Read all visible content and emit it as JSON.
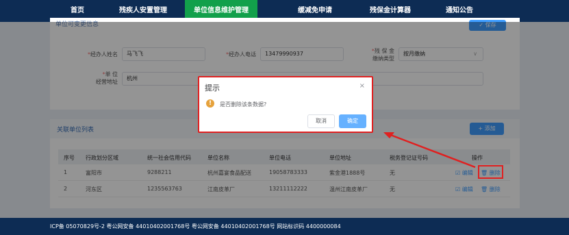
{
  "nav": {
    "items": [
      "首页",
      "残疾人安置管理",
      "单位信息维护管理",
      "缓减免申请",
      "残保金计算器",
      "通知公告"
    ],
    "active_index": 2
  },
  "card1": {
    "title": "单位可变更信息",
    "save_label": "✓ 保存",
    "fields": {
      "agent_name_label": "经办人姓名",
      "agent_name_value": "马飞飞",
      "agent_phone_label": "经办人电话",
      "agent_phone_value": "13479990937",
      "pay_type_label_1": "残 保 金",
      "pay_type_label_2": "缴纳类型",
      "pay_type_value": "按月缴纳",
      "address_label_1": "单 位",
      "address_label_2": "经营地址",
      "address_value": "杭州"
    }
  },
  "table": {
    "title": "关联单位列表",
    "add_label": "+ 添加",
    "headers": [
      "序号",
      "行政划分区域",
      "统一社会信用代码",
      "单位名称",
      "单位电话",
      "单位地址",
      "税务登记证号码",
      "操作"
    ],
    "rows": [
      [
        "1",
        "富阳市",
        "9288211",
        "杭州嘉宴食品配送",
        "19058783333",
        "紫金港1888号",
        "无"
      ],
      [
        "2",
        "河东区",
        "1235563763",
        "江南皮革厂",
        "13211112222",
        "温州江南皮革厂",
        "无"
      ]
    ],
    "edit_label": "☑ 编辑",
    "delete_label": "🗑 删除"
  },
  "modal": {
    "title": "提示",
    "close": "×",
    "message": "是否删除该条数据?",
    "cancel_label": "取消",
    "ok_label": "确定",
    "icon": "warning-icon"
  },
  "footer": {
    "text": "ICP备 05070829号-2 粤公网安备 44010402001768号 粤公网安备 44010402001768号 网站标识码 4400000084"
  },
  "colors": {
    "nav_bg": "#0d2c54",
    "nav_active": "#12a04b",
    "primary": "#409eff",
    "highlight": "#e02020",
    "warning": "#e6a23c"
  }
}
